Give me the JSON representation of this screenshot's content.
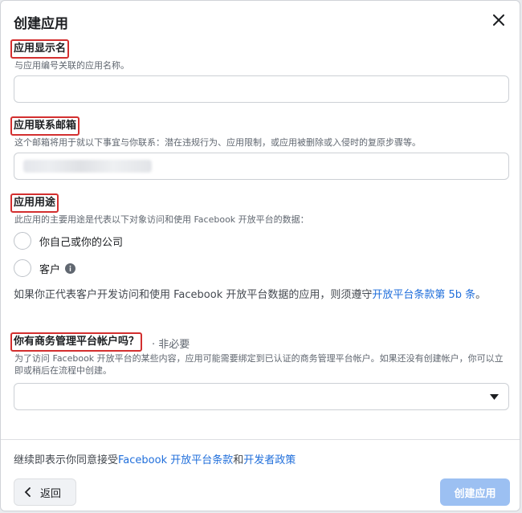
{
  "dialog": {
    "title": "创建应用",
    "close_icon": "close-icon"
  },
  "app_name": {
    "label": "应用显示名",
    "description": "与应用编号关联的应用名称。",
    "value": ""
  },
  "contact_email": {
    "label": "应用联系邮箱",
    "description": "这个邮箱将用于就以下事宜与你联系：潜在违规行为、应用限制，或应用被删除或入侵时的复原步骤等。"
  },
  "app_purpose": {
    "label": "应用用途",
    "description": "此应用的主要用途是代表以下对象访问和使用 Facebook 开放平台的数据：",
    "options": [
      {
        "label": "你自己或你的公司"
      },
      {
        "label": "客户"
      }
    ],
    "notice_text": "如果你正代表客户开发访问和使用 Facebook 开放平台数据的应用，则须遵守",
    "notice_link": "开放平台条款第 5b 条",
    "notice_end": "。"
  },
  "business_manager": {
    "label": "你有商务管理平台帐户吗？",
    "optional": "· 非必要",
    "description": "为了访问 Facebook 开放平台的某些内容，应用可能需要绑定到已认证的商务管理平台帐户。如果还没有创建帐户，你可以立即或稍后在流程中创建。",
    "selected": ""
  },
  "footer": {
    "agree_prefix": "继续即表示你同意接受",
    "terms_link": "Facebook 开放平台条款",
    "and": "和",
    "policy_link": "开发者政策",
    "back_label": "返回",
    "create_label": "创建应用"
  },
  "colors": {
    "accent": "#216fdb",
    "highlight_border": "#d32f2f",
    "disabled_button": "#9cc0f2"
  }
}
